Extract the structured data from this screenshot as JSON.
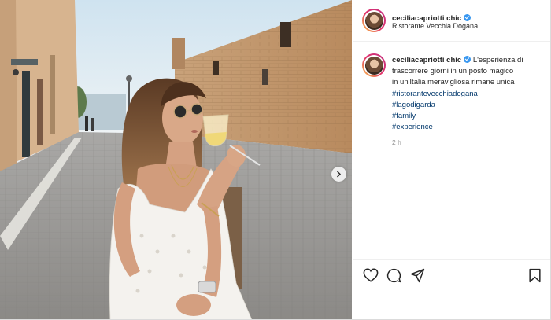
{
  "post": {
    "username": "ceciliacapriotti chic",
    "location": "Ristorante Vecchia Dogana",
    "caption": {
      "text_lines": [
        "L'esperienza di",
        "trascorrere giorni in un posto magico",
        "in un'Italia meravigliosa rimane unica"
      ],
      "hashtags": [
        "#ristorantevecchiadogana",
        "#lagodigarda",
        "#family",
        "#experience"
      ]
    },
    "timestamp": "2 h"
  },
  "icons": {
    "verified": "verified-badge-icon",
    "like": "heart-icon",
    "comment": "comment-icon",
    "share": "paper-plane-icon",
    "save": "bookmark-icon",
    "next": "chevron-right-icon"
  },
  "colors": {
    "verified": "#3897f0",
    "hashtag": "#00376b",
    "timestamp": "#8e8e8e",
    "divider": "#efefef"
  }
}
